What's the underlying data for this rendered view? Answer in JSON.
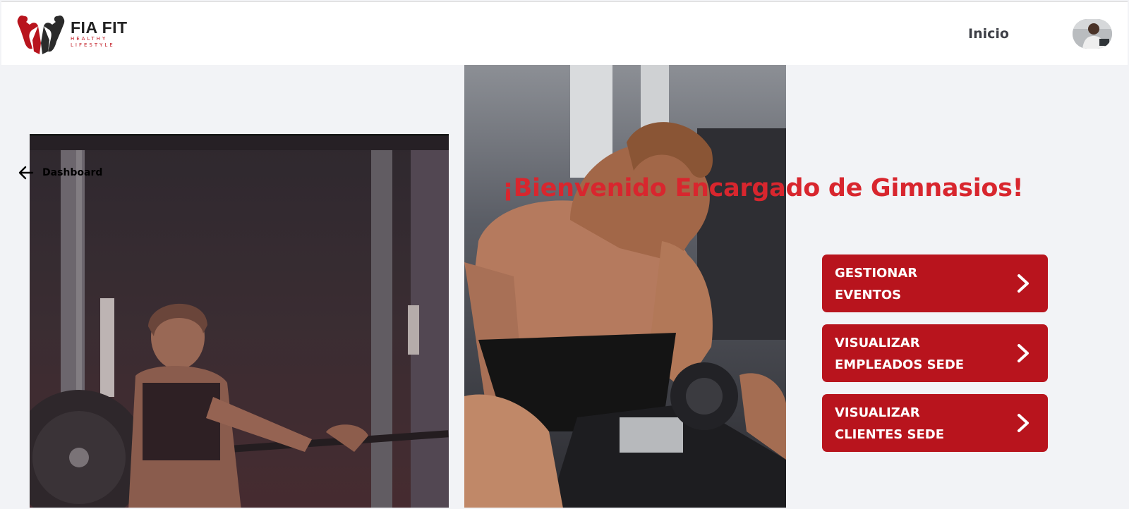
{
  "brand": {
    "name": "FIA FIT",
    "tagline_line1": "HEALTHY",
    "tagline_line2": "LIFESTYLE",
    "accent_color": "#c0161f"
  },
  "header": {
    "nav_inicio": "Inicio",
    "avatar_icon": "user-avatar"
  },
  "back_link": {
    "icon": "arrow-left-icon",
    "label": "Dashboard"
  },
  "main": {
    "welcome_title": "¡Bienvenido Encargado de Gimnasios!",
    "title_color": "#d8262e"
  },
  "actions": [
    {
      "line1": "GESTIONAR",
      "line2": "EVENTOS",
      "icon": "chevron-right-icon"
    },
    {
      "line1": "VISUALIZAR",
      "line2": "EMPLEADOS SEDE",
      "icon": "chevron-right-icon"
    },
    {
      "line1": "VISUALIZAR",
      "line2": "CLIENTES SEDE",
      "icon": "chevron-right-icon"
    }
  ],
  "colors": {
    "button_bg": "#b8141d",
    "page_bg": "#f2f3f6"
  }
}
